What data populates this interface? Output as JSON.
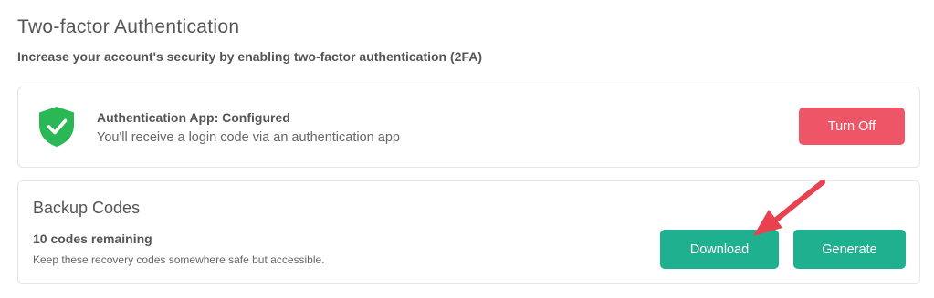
{
  "header": {
    "title": "Two-factor Authentication",
    "subtitle": "Increase your account's security by enabling two-factor authentication (2FA)"
  },
  "auth_card": {
    "icon": "shield-check-icon",
    "title": "Authentication App: Configured",
    "description": "You'll receive a login code via an authentication app",
    "turn_off_label": "Turn Off"
  },
  "backup_card": {
    "title": "Backup Codes",
    "remaining": "10 codes remaining",
    "note": "Keep these recovery codes somewhere safe but accessible.",
    "download_label": "Download",
    "generate_label": "Generate"
  },
  "colors": {
    "shield": "#2ab756",
    "danger": "#ee5566",
    "primary": "#1fb08f",
    "annotation_arrow": "#e8424f"
  }
}
